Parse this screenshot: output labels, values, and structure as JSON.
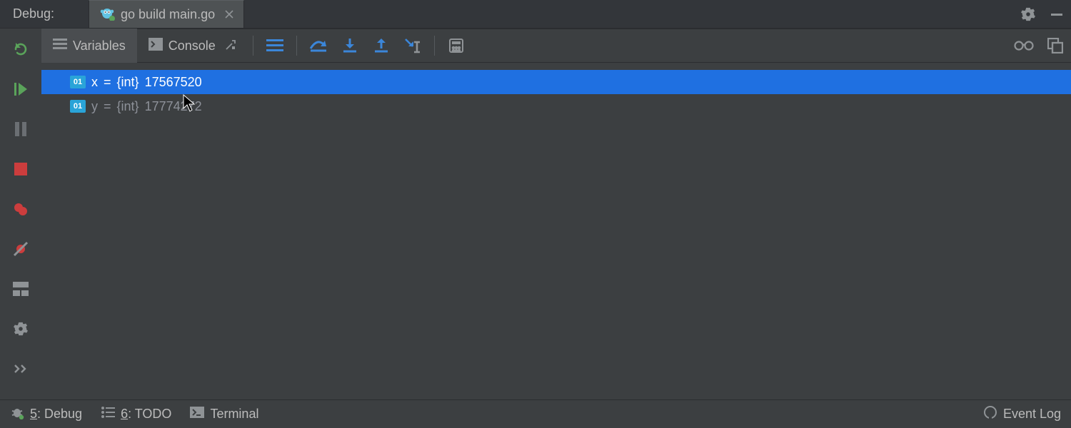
{
  "header": {
    "debug_label": "Debug:",
    "tab_label": "go build main.go"
  },
  "tabs": {
    "variables": "Variables",
    "console": "Console"
  },
  "variables": [
    {
      "badge": "01",
      "name": "x",
      "eq": "=",
      "type": "{int}",
      "value": "17567520",
      "selected": true
    },
    {
      "badge": "01",
      "name": "y",
      "eq": "=",
      "type": "{int}",
      "value": "17774272",
      "selected": false
    }
  ],
  "status": {
    "debug_num": "5",
    "debug_label": ": Debug",
    "todo_num": "6",
    "todo_label": ": TODO",
    "terminal_label": "Terminal",
    "event_log": "Event Log"
  }
}
